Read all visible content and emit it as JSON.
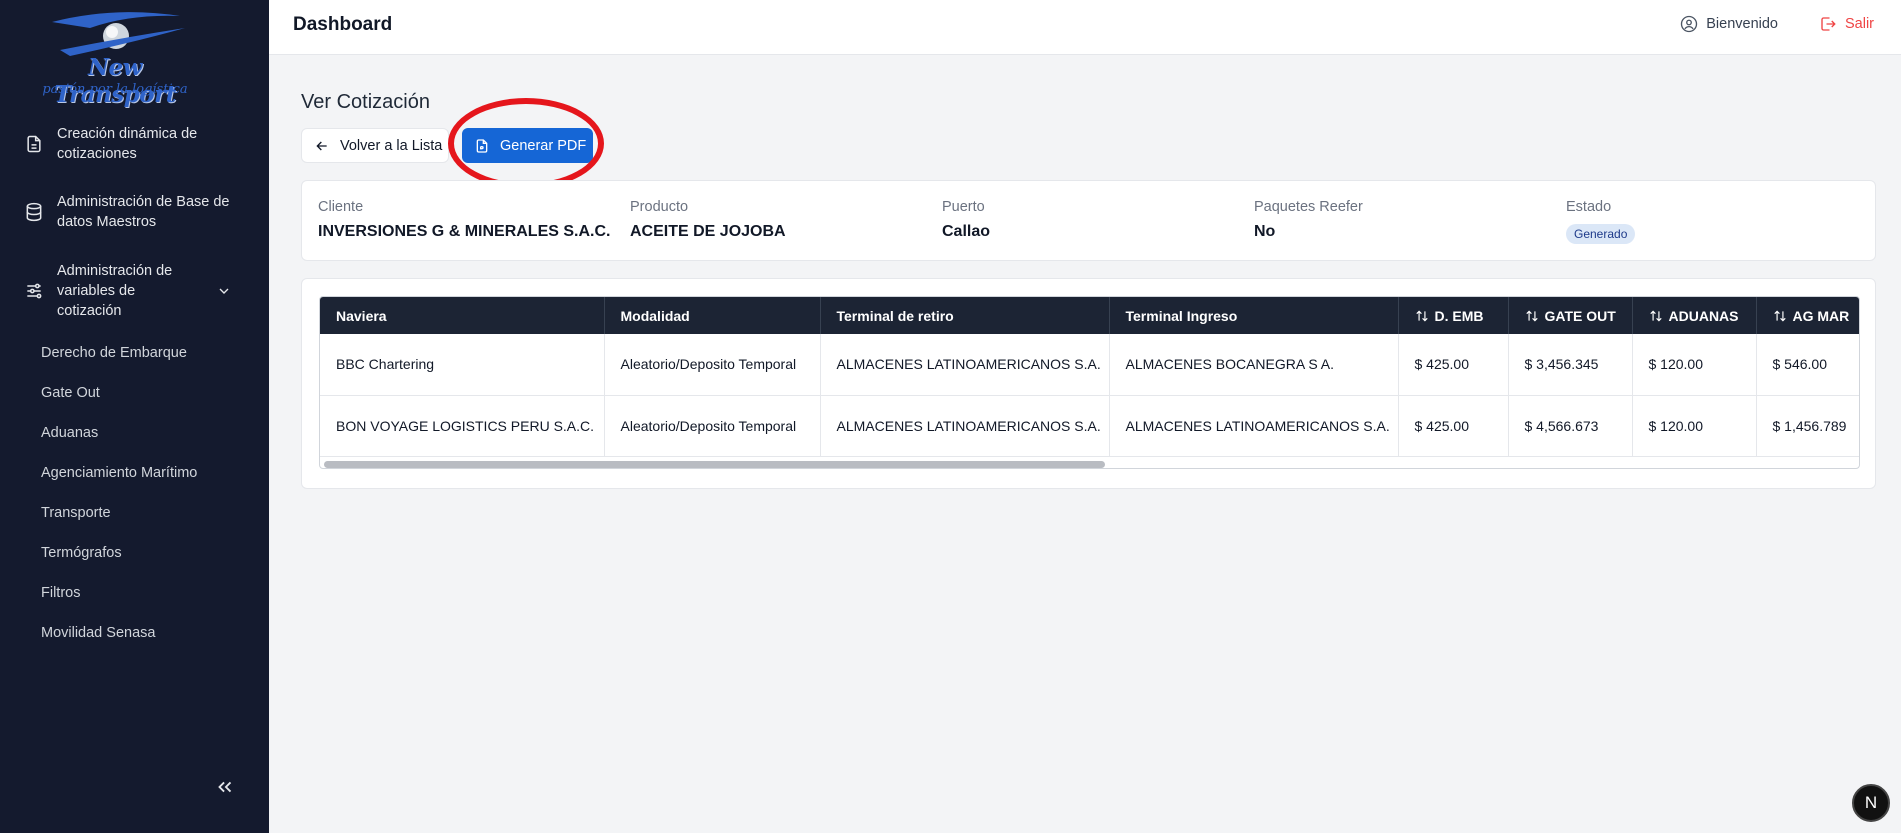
{
  "sidebar": {
    "logo_text": "New Transport",
    "logo_sub": "pasión por la logística",
    "items": [
      {
        "label": "Creación dinámica de cotizaciones",
        "icon": "document-icon"
      },
      {
        "label": "Administración de Base de datos Maestros",
        "icon": "database-icon"
      },
      {
        "label": "Administración de variables de cotización",
        "icon": "sliders-icon"
      }
    ],
    "subitems": [
      "Derecho de Embarque",
      "Gate Out",
      "Aduanas",
      "Agenciamiento Marítimo",
      "Transporte",
      "Termógrafos",
      "Filtros",
      "Movilidad Senasa"
    ]
  },
  "header": {
    "title": "Dashboard",
    "welcome": "Bienvenido",
    "logout": "Salir"
  },
  "page": {
    "title": "Ver Cotización",
    "back_label": "Volver a la Lista",
    "pdf_label": "Generar PDF"
  },
  "info": {
    "cliente_label": "Cliente",
    "cliente": "INVERSIONES G & MINERALES S.A.C.",
    "producto_label": "Producto",
    "producto": "ACEITE DE JOJOBA",
    "puerto_label": "Puerto",
    "puerto": "Callao",
    "reefer_label": "Paquetes Reefer",
    "reefer": "No",
    "estado_label": "Estado",
    "estado": "Generado"
  },
  "table": {
    "headers": [
      "Naviera",
      "Modalidad",
      "Terminal de retiro",
      "Terminal Ingreso",
      "D. EMB",
      "GATE OUT",
      "ADUANAS",
      "AG MAR"
    ],
    "rows": [
      [
        "BBC Chartering",
        "Aleatorio/Deposito Temporal",
        "ALMACENES LATINOAMERICANOS S.A.",
        "ALMACENES BOCANEGRA S A.",
        "$ 425.00",
        "$ 3,456.345",
        "$ 120.00",
        "$ 546.00"
      ],
      [
        "BON VOYAGE LOGISTICS PERU S.A.C.",
        "Aleatorio/Deposito Temporal",
        "ALMACENES LATINOAMERICANOS S.A.",
        "ALMACENES LATINOAMERICANOS S.A.",
        "$ 425.00",
        "$ 4,566.673",
        "$ 120.00",
        "$ 1,456.789"
      ]
    ]
  },
  "dev_badge": "N",
  "colors": {
    "sidebar": "#141a2e",
    "primary": "#1566d6",
    "danger": "#ef4444",
    "table_header": "#1c2434",
    "highlight": "#e5161c"
  }
}
